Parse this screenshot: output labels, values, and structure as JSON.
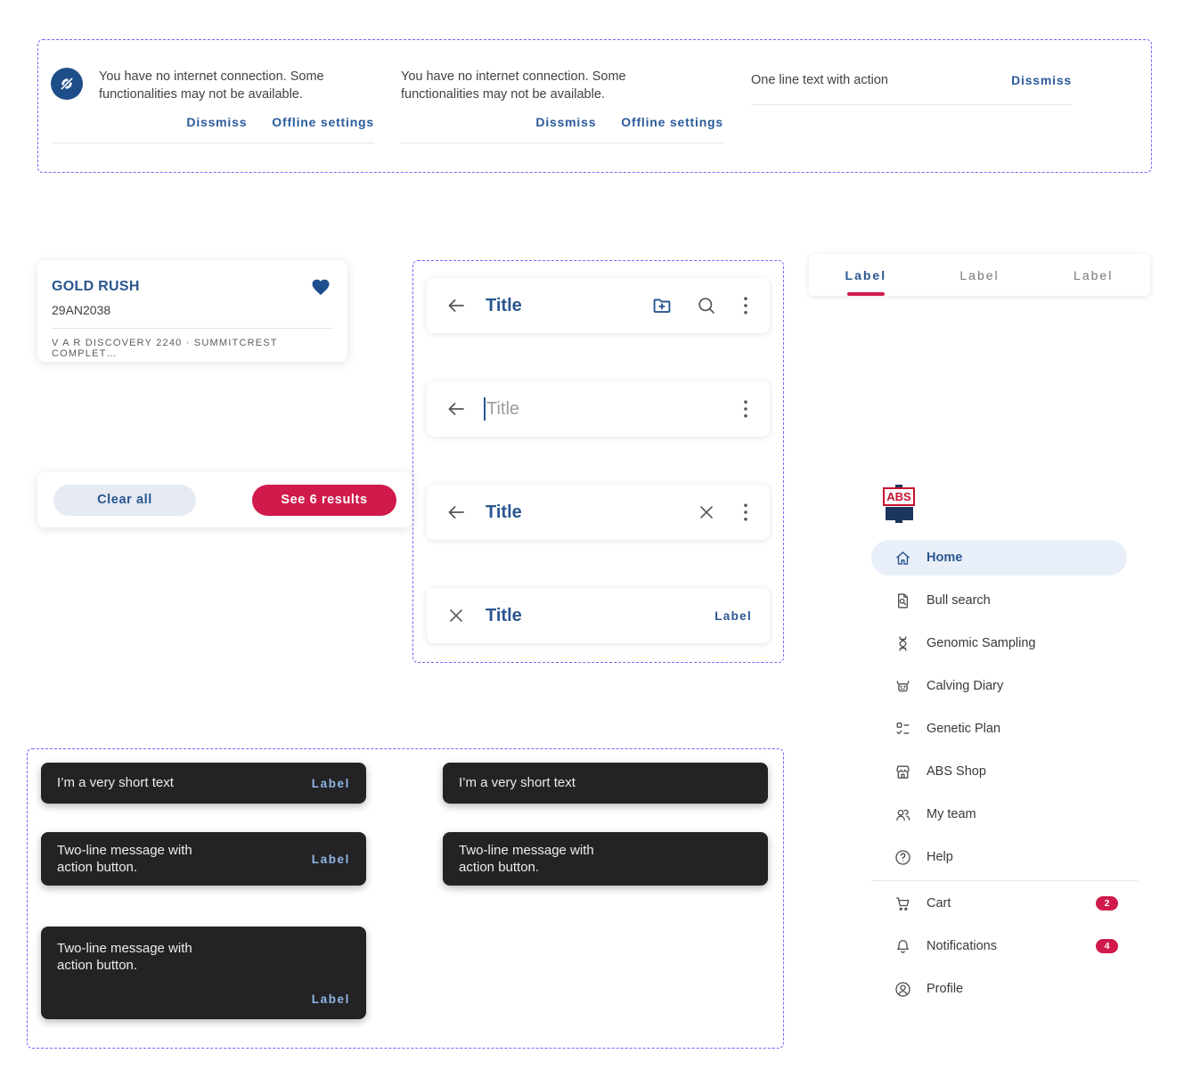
{
  "colors": {
    "primary_blue": "#2A5690",
    "accent_crimson": "#D01A4B",
    "logo_red": "#C8102E",
    "logo_navy": "#1B365D",
    "snackbar_bg": "#232325",
    "snackbar_action_blue": "#8FB5E3",
    "dashed_outline_purple": "#7B61FF"
  },
  "offline_banners": {
    "with_icon": {
      "message": "You have no internet connection. Some functionalities may not be available.",
      "dismiss_label": "Dissmiss",
      "settings_label": "Offline settings"
    },
    "text_only": {
      "message": "You have no internet connection. Some functionalities may not be available.",
      "dismiss_label": "Dissmiss",
      "settings_label": "Offline settings"
    },
    "one_line": {
      "message": "One line text with action",
      "dismiss_label": "Dissmiss"
    }
  },
  "bull_card": {
    "name": "GOLD RUSH",
    "code": "29AN2038",
    "pedigree": "V A R DISCOVERY 2240 · SUMMITCREST COMPLET…"
  },
  "filter_bar": {
    "clear_label": "Clear all",
    "results_label": "See 6 results"
  },
  "app_bars": {
    "default": {
      "title": "Title"
    },
    "search_input": {
      "placeholder": "Title"
    },
    "with_clear": {
      "title": "Title"
    },
    "modal": {
      "title": "Title",
      "action_label": "Label"
    }
  },
  "tabs": {
    "items": [
      {
        "label": "Label",
        "active": true
      },
      {
        "label": "Label",
        "active": false
      },
      {
        "label": "Label",
        "active": false
      }
    ]
  },
  "nav": {
    "logo_text": "ABS",
    "items": [
      {
        "label": "Home",
        "icon": "home-icon",
        "active": true
      },
      {
        "label": "Bull search",
        "icon": "bull-search-icon"
      },
      {
        "label": "Genomic Sampling",
        "icon": "dna-icon"
      },
      {
        "label": "Calving Diary",
        "icon": "cow-icon"
      },
      {
        "label": "Genetic Plan",
        "icon": "checklist-icon"
      },
      {
        "label": "ABS Shop",
        "icon": "storefront-icon"
      },
      {
        "label": "My team",
        "icon": "team-icon"
      },
      {
        "label": "Help",
        "icon": "help-icon"
      },
      {
        "label": "Cart",
        "icon": "cart-icon",
        "badge": "2"
      },
      {
        "label": "Notifications",
        "icon": "bell-icon",
        "badge": "4"
      },
      {
        "label": "Profile",
        "icon": "profile-icon"
      }
    ]
  },
  "snackbars": {
    "short_with_action": {
      "message": "I’m a very short text",
      "action_label": "Label"
    },
    "two_line_with_action": {
      "message": "Two-line message with action button.",
      "action_label": "Label"
    },
    "two_line_action_below": {
      "message": "Two-line message with action button.",
      "action_label": "Label"
    },
    "short_plain": {
      "message": "I’m a very short text"
    },
    "two_line_plain": {
      "message": "Two-line message with action button."
    }
  }
}
